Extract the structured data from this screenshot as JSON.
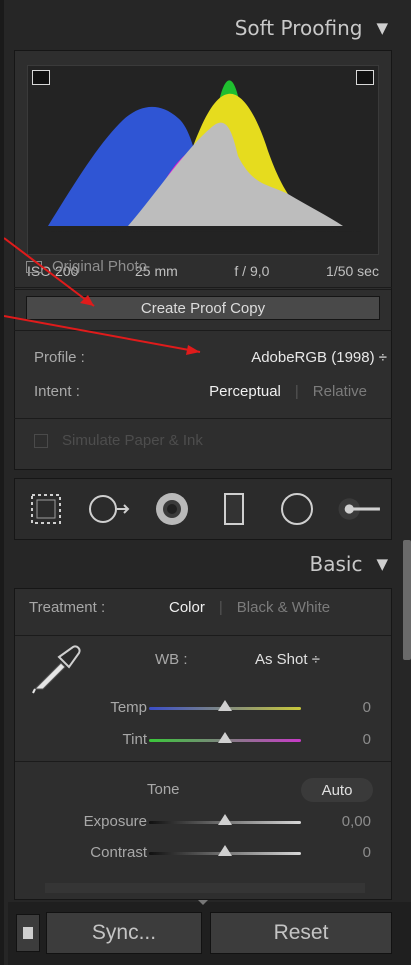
{
  "soft_proofing": {
    "title": "Soft Proofing",
    "meta": {
      "iso": "ISO 200",
      "focal": "25 mm",
      "aperture": "f / 9,0",
      "shutter": "1/50 sec"
    },
    "original_photo_label": "Original Photo",
    "create_proof_label": "Create Proof Copy",
    "profile_label": "Profile :",
    "profile_value": "AdobeRGB (1998) ÷",
    "intent_label": "Intent :",
    "intent_options": [
      "Perceptual",
      "Relative"
    ],
    "intent_selected": "Perceptual",
    "simulate_label": "Simulate Paper & Ink"
  },
  "tools": [
    "crop-overlay-icon",
    "spot-removal-icon",
    "red-eye-icon",
    "graduated-filter-icon",
    "radial-filter-icon",
    "adjustment-brush-icon"
  ],
  "basic": {
    "title": "Basic",
    "treatment_label": "Treatment :",
    "treatment_options": [
      "Color",
      "Black & White"
    ],
    "treatment_selected": "Color",
    "wb_label": "WB :",
    "wb_value": "As Shot ÷",
    "temp_label": "Temp",
    "temp_value": "0",
    "tint_label": "Tint",
    "tint_value": "0",
    "tone_label": "Tone",
    "auto_label": "Auto",
    "exposure_label": "Exposure",
    "exposure_value": "0,00",
    "contrast_label": "Contrast",
    "contrast_value": "0"
  },
  "bottom": {
    "sync_label": "Sync...",
    "reset_label": "Reset"
  },
  "colors": {
    "annotation_arrow": "#e01b1b",
    "accent_blue": "#2f55d4",
    "green": "#1fbf2f",
    "yellow": "#e6dc1e",
    "magenta": "#e01ad8"
  }
}
